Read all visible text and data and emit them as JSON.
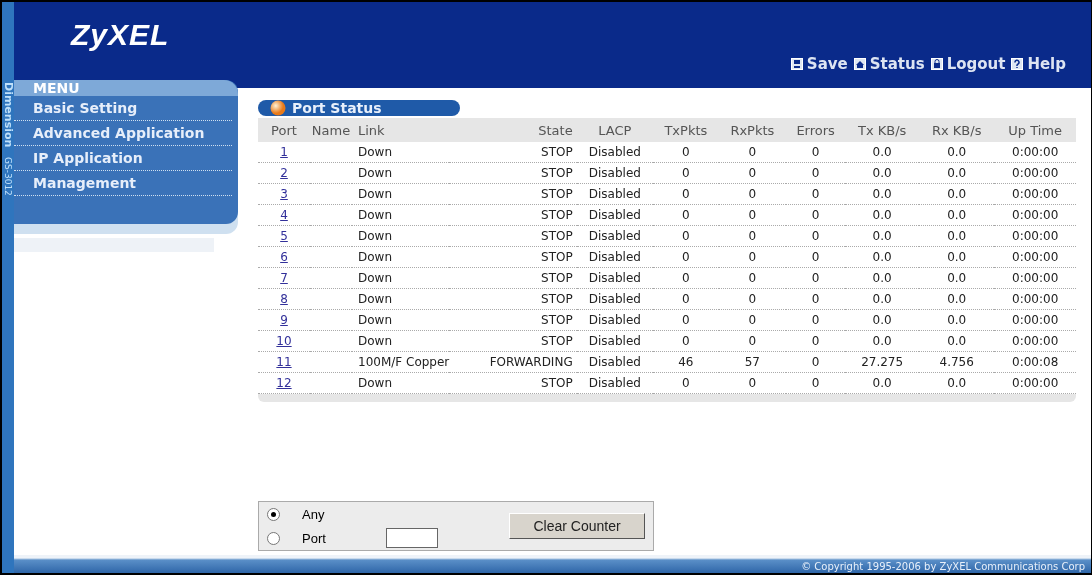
{
  "brand": {
    "logo": "ZyXEL",
    "product": "Dimension",
    "model": "GS-3012"
  },
  "top_links": [
    {
      "label": "Save",
      "kind": "save"
    },
    {
      "label": "Status",
      "kind": "home"
    },
    {
      "label": "Logout",
      "kind": "lock"
    },
    {
      "label": "Help",
      "kind": "help"
    }
  ],
  "menu": {
    "title": "MENU",
    "items": [
      "Basic Setting",
      "Advanced Application",
      "IP Application",
      "Management"
    ]
  },
  "panel_title": "Port Status",
  "table": {
    "columns": [
      "Port",
      "Name",
      "Link",
      "State",
      "LACP",
      "TxPkts",
      "RxPkts",
      "Errors",
      "Tx KB/s",
      "Rx KB/s",
      "Up Time"
    ],
    "rows": [
      [
        "1",
        "",
        "Down",
        "STOP",
        "Disabled",
        "0",
        "0",
        "0",
        "0.0",
        "0.0",
        "0:00:00"
      ],
      [
        "2",
        "",
        "Down",
        "STOP",
        "Disabled",
        "0",
        "0",
        "0",
        "0.0",
        "0.0",
        "0:00:00"
      ],
      [
        "3",
        "",
        "Down",
        "STOP",
        "Disabled",
        "0",
        "0",
        "0",
        "0.0",
        "0.0",
        "0:00:00"
      ],
      [
        "4",
        "",
        "Down",
        "STOP",
        "Disabled",
        "0",
        "0",
        "0",
        "0.0",
        "0.0",
        "0:00:00"
      ],
      [
        "5",
        "",
        "Down",
        "STOP",
        "Disabled",
        "0",
        "0",
        "0",
        "0.0",
        "0.0",
        "0:00:00"
      ],
      [
        "6",
        "",
        "Down",
        "STOP",
        "Disabled",
        "0",
        "0",
        "0",
        "0.0",
        "0.0",
        "0:00:00"
      ],
      [
        "7",
        "",
        "Down",
        "STOP",
        "Disabled",
        "0",
        "0",
        "0",
        "0.0",
        "0.0",
        "0:00:00"
      ],
      [
        "8",
        "",
        "Down",
        "STOP",
        "Disabled",
        "0",
        "0",
        "0",
        "0.0",
        "0.0",
        "0:00:00"
      ],
      [
        "9",
        "",
        "Down",
        "STOP",
        "Disabled",
        "0",
        "0",
        "0",
        "0.0",
        "0.0",
        "0:00:00"
      ],
      [
        "10",
        "",
        "Down",
        "STOP",
        "Disabled",
        "0",
        "0",
        "0",
        "0.0",
        "0.0",
        "0:00:00"
      ],
      [
        "11",
        "",
        "100M/F Copper",
        "FORWARDING",
        "Disabled",
        "46",
        "57",
        "0",
        "27.275",
        "4.756",
        "0:00:08"
      ],
      [
        "12",
        "",
        "Down",
        "STOP",
        "Disabled",
        "0",
        "0",
        "0",
        "0.0",
        "0.0",
        "0:00:00"
      ]
    ]
  },
  "clear_form": {
    "options": [
      {
        "label": "Any",
        "selected": true
      },
      {
        "label": "Port",
        "selected": false
      }
    ],
    "button": "Clear Counter"
  },
  "footer": "© Copyright 1995-2006 by ZyXEL Communications Corp"
}
